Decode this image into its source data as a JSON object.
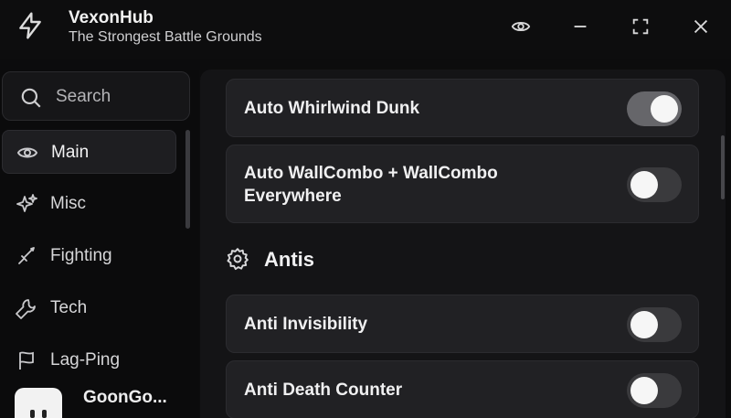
{
  "app": {
    "title": "VexonHub",
    "subtitle": "The Strongest Battle Grounds",
    "logo_icon": "lightning-bolt-icon",
    "window_controls": [
      "eye-icon",
      "minimize-icon",
      "maximize-icon",
      "close-icon"
    ]
  },
  "sidebar": {
    "search_placeholder": "Search",
    "items": [
      {
        "label": "Main",
        "icon": "eye-icon",
        "active": true
      },
      {
        "label": "Misc",
        "icon": "sparkles-icon",
        "active": false
      },
      {
        "label": "Fighting",
        "icon": "sword-icon",
        "active": false
      },
      {
        "label": "Tech",
        "icon": "wrench-icon",
        "active": false
      },
      {
        "label": "Lag-Ping",
        "icon": "flag-icon",
        "active": false
      }
    ],
    "user": {
      "name": "GoonGo..."
    }
  },
  "main": {
    "options_top": [
      {
        "label": "Auto Whirlwind Dunk",
        "enabled": true
      },
      {
        "label": "Auto WallCombo + WallCombo Everywhere",
        "enabled": false
      }
    ],
    "section": {
      "title": "Antis",
      "icon": "gear-icon"
    },
    "options_antis": [
      {
        "label": "Anti Invisibility",
        "enabled": false
      },
      {
        "label": "Anti Death Counter",
        "enabled": false
      }
    ]
  },
  "colors": {
    "background": "#0c0c0d",
    "panel": "#141416",
    "row": "#212124",
    "toggle_on": "#66666a",
    "toggle_off": "#3a3a3d",
    "knob": "#f6f6f6"
  }
}
